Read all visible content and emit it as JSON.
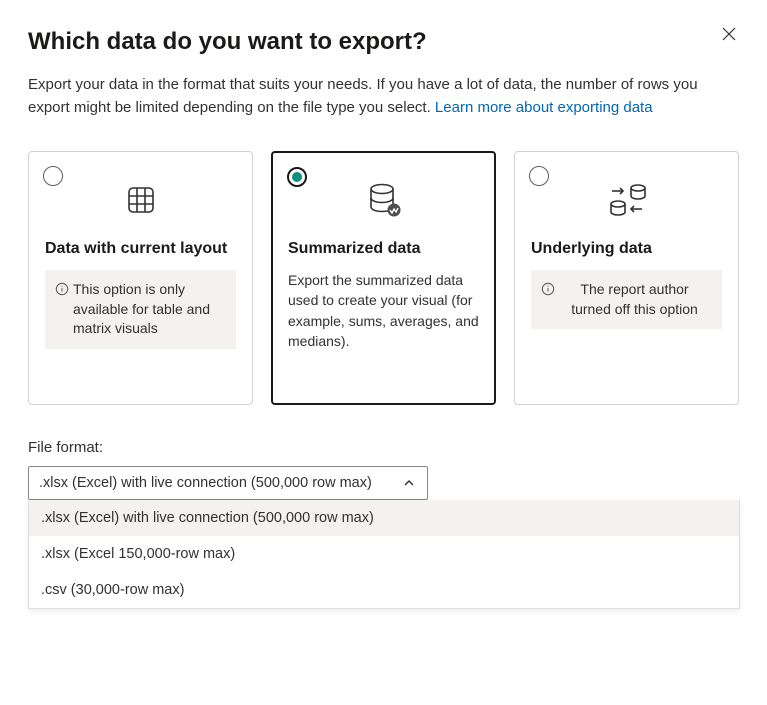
{
  "title": "Which data do you want to export?",
  "intro_text": "Export your data in the format that suits your needs. If you have a lot of data, the number of rows you export might be limited depending on the file type you select.  ",
  "intro_link": "Learn more about exporting data",
  "cards": {
    "layout": {
      "title": "Data with current layout",
      "note": "This option is only available for table and matrix visuals"
    },
    "summarized": {
      "title": "Summarized data",
      "desc": "Export the summarized data used to create your visual (for example, sums, averages, and medians)."
    },
    "underlying": {
      "title": "Underlying data",
      "note": "The report author turned off this option"
    }
  },
  "format_label": "File format:",
  "dropdown_selected": ".xlsx (Excel) with live connection (500,000 row max)",
  "dropdown_options": [
    ".xlsx (Excel) with live connection (500,000 row max)",
    ".xlsx (Excel 150,000-row max)",
    ".csv (30,000-row max)"
  ]
}
